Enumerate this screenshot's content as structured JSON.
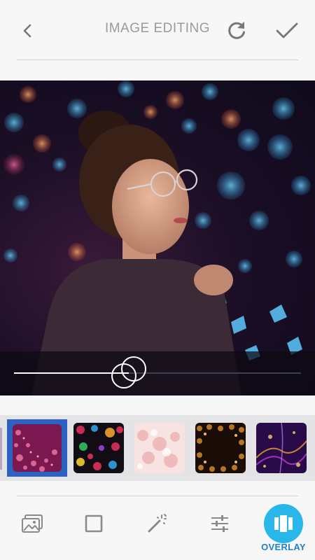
{
  "header": {
    "title": "IMAGE EDITING",
    "icons": {
      "back": "chevron-left-icon",
      "refresh": "refresh-icon",
      "confirm": "check-icon"
    }
  },
  "editor": {
    "opacity_fraction": 0.4
  },
  "overlays": [
    {
      "name": "pink-bokeh",
      "selected": true,
      "colors": [
        "#5a1040",
        "#c0306a",
        "#e8507a"
      ]
    },
    {
      "name": "hearts",
      "selected": false,
      "colors": [
        "#120c14",
        "#e0305a",
        "#30a0e0"
      ]
    },
    {
      "name": "light-bokeh",
      "selected": false,
      "colors": [
        "#f4d6d4",
        "#e89a9a",
        "#fff1ee"
      ]
    },
    {
      "name": "gold-frame",
      "selected": false,
      "colors": [
        "#1a0c06",
        "#d08a2a",
        "#ffd27a"
      ]
    },
    {
      "name": "purple-sparks",
      "selected": false,
      "colors": [
        "#2a0b4a",
        "#a82aa8",
        "#f0a030"
      ]
    }
  ],
  "toolbar": {
    "overlay_label": "OVERLAY",
    "icons": [
      "gallery-icon",
      "frame-icon",
      "magic-wand-icon",
      "sliders-icon",
      "overlay-icon"
    ]
  },
  "colors": {
    "accent": "#29b6e8",
    "selection": "#2d62c4",
    "label": "#1f7fd1"
  }
}
